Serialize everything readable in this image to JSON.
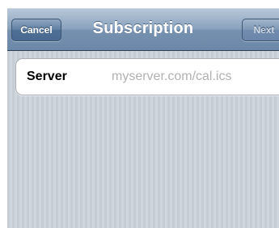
{
  "navbar": {
    "title": "Subscription",
    "cancel_label": "Cancel",
    "next_label": "Next"
  },
  "form": {
    "server_label": "Server",
    "server_value": "",
    "server_placeholder": "myserver.com/cal.ics"
  },
  "colors": {
    "navbar_accent": "#7691b0",
    "background_stripes": "#cbd2d9",
    "placeholder": "#b1b1b1"
  }
}
